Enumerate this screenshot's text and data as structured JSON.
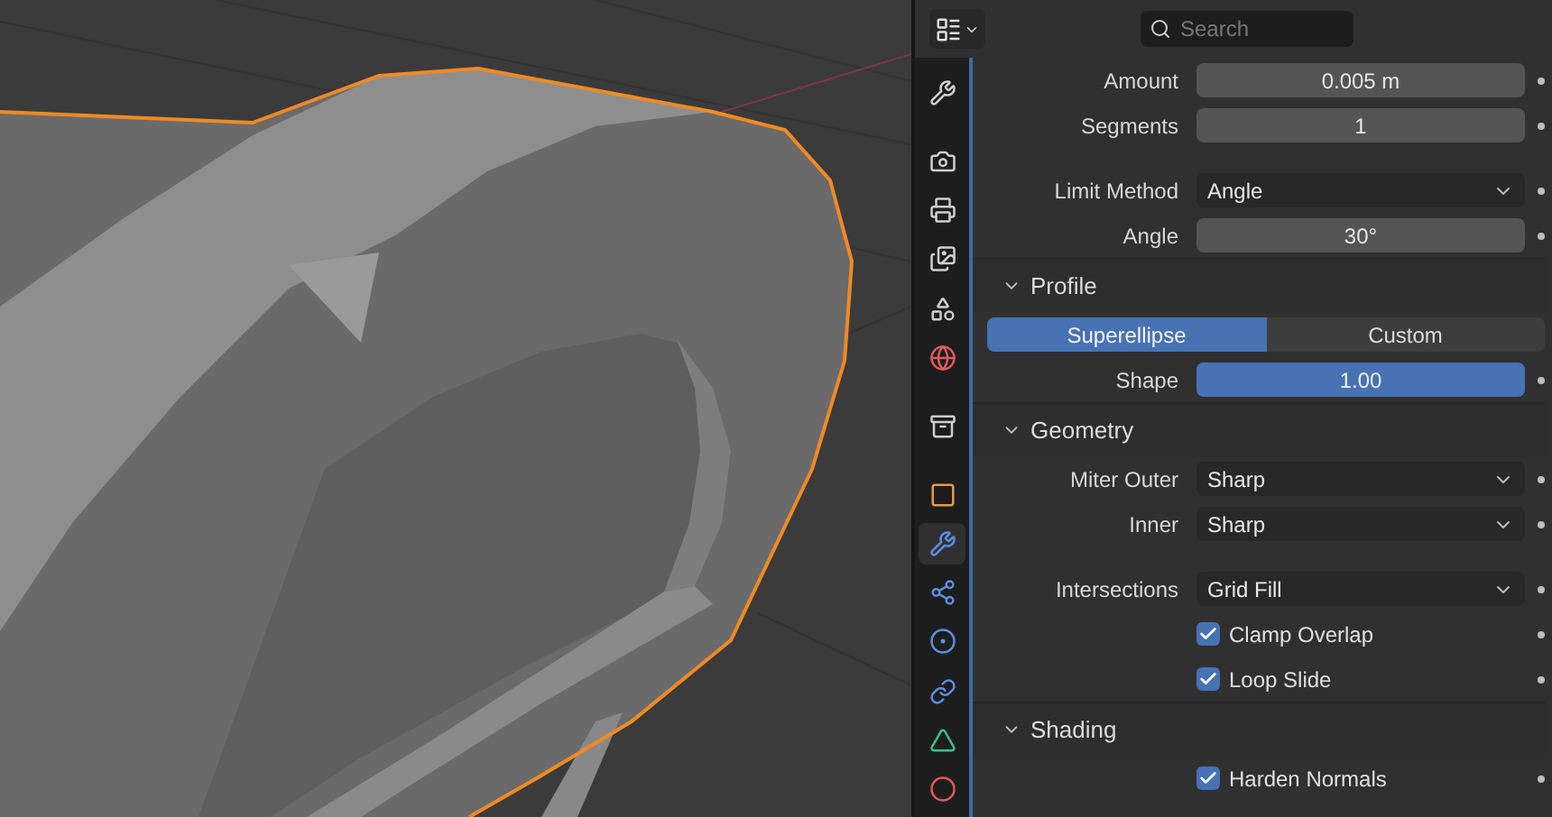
{
  "header": {
    "search": {
      "placeholder": "Search"
    }
  },
  "tabs": [
    {
      "kind": "tool",
      "selected": false
    },
    {
      "kind": "render",
      "selected": false
    },
    {
      "kind": "output",
      "selected": false
    },
    {
      "kind": "view_layer",
      "selected": false
    },
    {
      "kind": "scene",
      "selected": false
    },
    {
      "kind": "world",
      "selected": false
    },
    {
      "kind": "collection",
      "selected": false
    },
    {
      "kind": "object",
      "selected": false
    },
    {
      "kind": "modifiers",
      "selected": true
    },
    {
      "kind": "particles",
      "selected": false
    },
    {
      "kind": "physics",
      "selected": false
    },
    {
      "kind": "constraints",
      "selected": false
    },
    {
      "kind": "data",
      "selected": false
    },
    {
      "kind": "material",
      "selected": false
    }
  ],
  "rows": [
    {
      "kind": "number",
      "label": "Amount",
      "value": "0.005 m"
    },
    {
      "kind": "number",
      "label": "Segments",
      "value": "1"
    },
    {
      "kind": "spacer"
    },
    {
      "kind": "dropdown",
      "label": "Limit Method",
      "value": "Angle"
    },
    {
      "kind": "number",
      "label": "Angle",
      "value": "30°"
    },
    {
      "kind": "section",
      "label": "Profile",
      "expanded": true
    },
    {
      "kind": "tabs",
      "options": [
        {
          "label": "Superellipse",
          "selected": true
        },
        {
          "label": "Custom",
          "selected": false
        }
      ]
    },
    {
      "kind": "slider",
      "label": "Shape",
      "value": "1.00",
      "level": 1
    },
    {
      "kind": "section",
      "label": "Geometry",
      "expanded": true
    },
    {
      "kind": "dropdown",
      "label": "Miter Outer",
      "value": "Sharp"
    },
    {
      "kind": "dropdown",
      "label": "Inner",
      "value": "Sharp"
    },
    {
      "kind": "spacer"
    },
    {
      "kind": "dropdown",
      "label": "Intersections",
      "value": "Grid Fill"
    },
    {
      "kind": "checkbox",
      "label": "Clamp Overlap",
      "checked": true
    },
    {
      "kind": "checkbox",
      "label": "Loop Slide",
      "checked": true
    },
    {
      "kind": "section",
      "label": "Shading",
      "expanded": true
    },
    {
      "kind": "checkbox",
      "label": "Harden Normals",
      "checked": true
    }
  ]
}
